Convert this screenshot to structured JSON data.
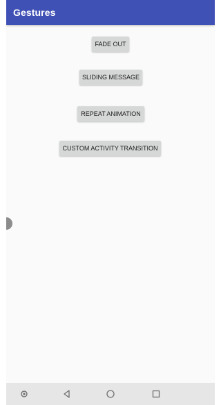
{
  "app_bar": {
    "title": "Gestures",
    "color": "#3f51b5"
  },
  "buttons": {
    "fade_out": "FADE OUT",
    "sliding_message": "SLIDING MESSAGE",
    "repeat_animation": "REPEAT ANIMATION",
    "custom_activity_transition": "CUSTOM ACTIVITY TRANSITION"
  },
  "side_handle": {
    "icon": "edge-handle-icon"
  },
  "nav_bar": {
    "items": [
      {
        "icon": "dot-icon"
      },
      {
        "icon": "back-triangle-icon"
      },
      {
        "icon": "home-circle-icon"
      },
      {
        "icon": "recents-square-icon"
      }
    ]
  }
}
